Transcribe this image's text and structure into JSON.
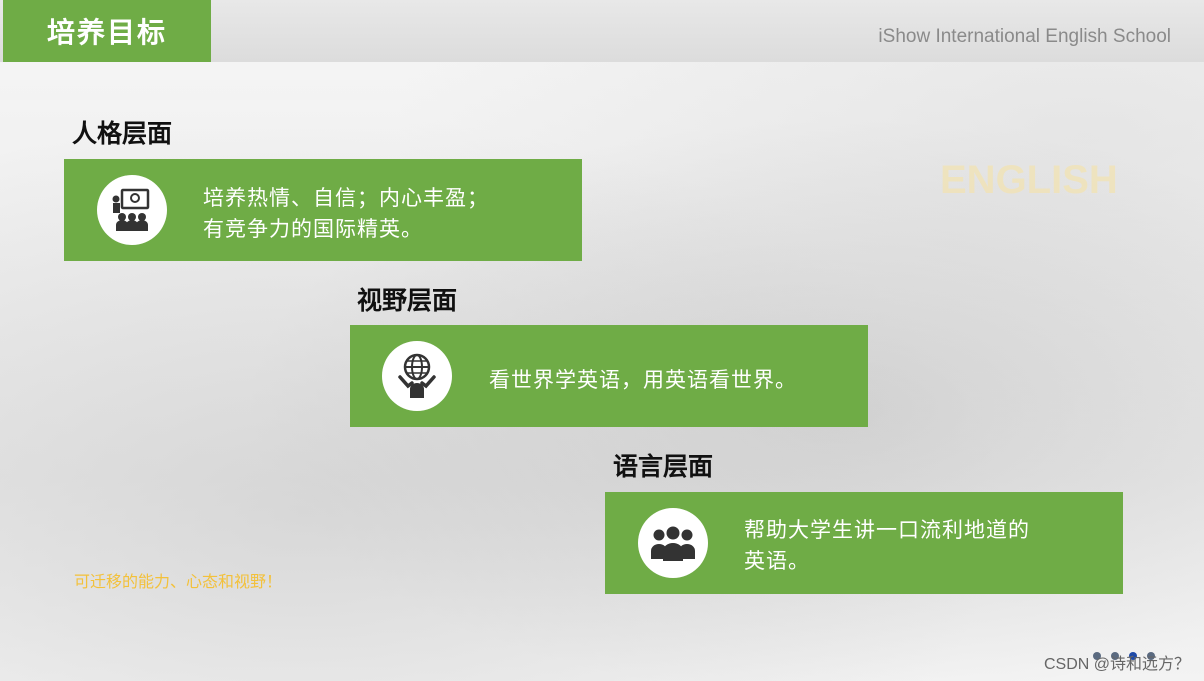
{
  "header": {
    "title": "培养目标",
    "school": "iShow International English School"
  },
  "decor": {
    "english_word": "ENGLISH"
  },
  "sections": [
    {
      "heading": "人格层面",
      "text": "培养热情、自信；内心丰盈；\n有竞争力的国际精英。",
      "icon": "teacher-presentation-icon"
    },
    {
      "heading": "视野层面",
      "text": "看世界学英语，用英语看世界。",
      "icon": "globe-person-icon"
    },
    {
      "heading": "语言层面",
      "text": "帮助大学生讲一口流利地道的\n英语。",
      "icon": "group-people-icon"
    }
  ],
  "tagline": "可迁移的能力、心态和视野！",
  "watermark": "CSDN @诗和远方？",
  "colors": {
    "accent": "#6fac46",
    "tagline": "#f3c13a"
  }
}
